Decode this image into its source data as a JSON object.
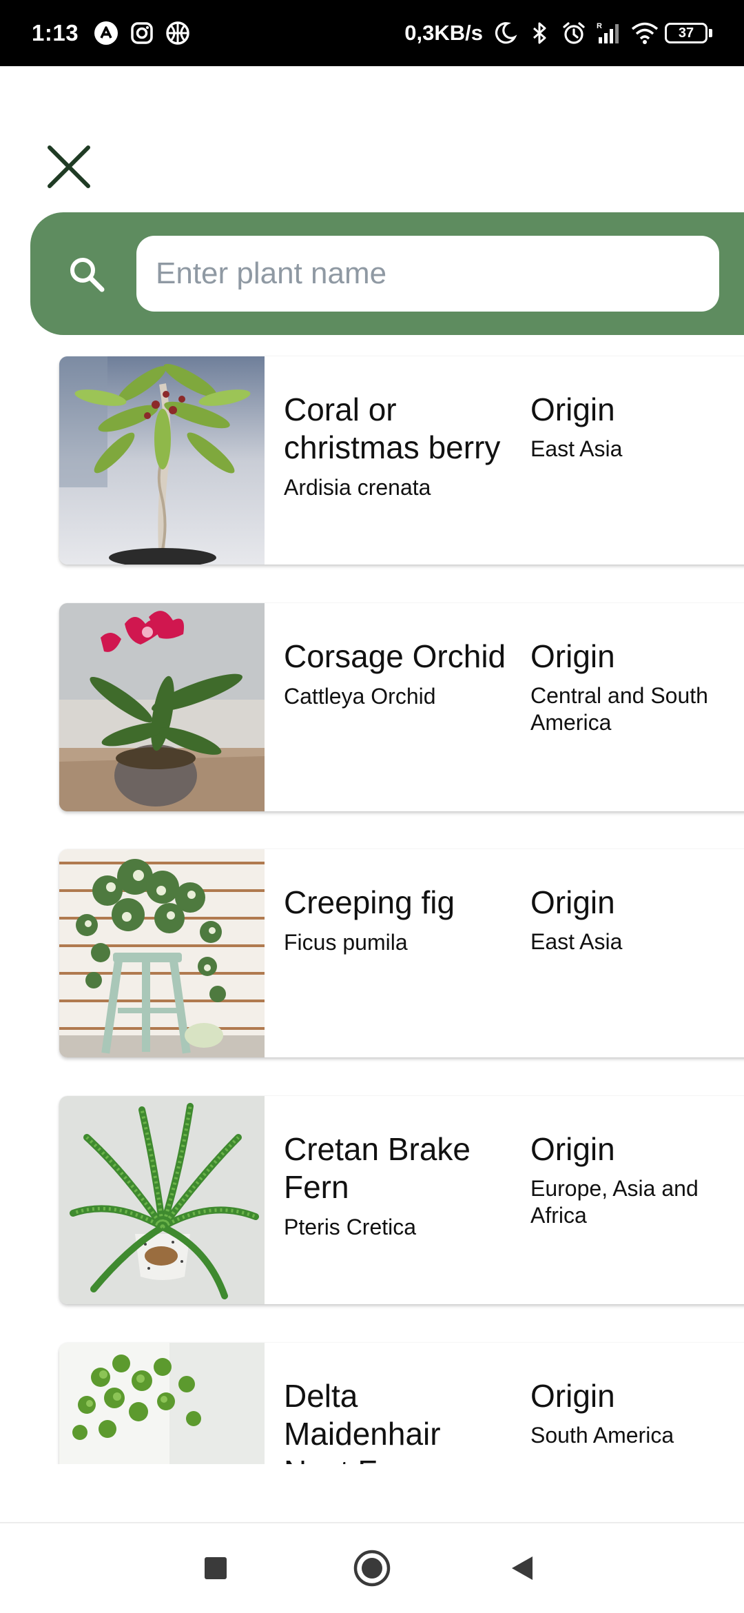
{
  "status_bar": {
    "time": "1:13",
    "network_speed": "0,3KB/s",
    "battery": "37",
    "left_icons": [
      "app-a-icon",
      "instagram-icon",
      "basketball-icon"
    ],
    "right_icons": [
      "moon-icon",
      "bluetooth-icon",
      "alarm-icon",
      "signal-icon",
      "wifi-icon",
      "battery-icon"
    ]
  },
  "header": {
    "close_icon": "close-icon"
  },
  "search": {
    "placeholder": "Enter plant name",
    "value": "",
    "icon": "search-icon"
  },
  "plants": [
    {
      "name": "Coral or christmas berry",
      "scientific": "Ardisia crenata",
      "origin_label": "Origin",
      "origin": "East Asia"
    },
    {
      "name": "Corsage Orchid",
      "scientific": "Cattleya Orchid",
      "origin_label": "Origin",
      "origin": "Central and South America"
    },
    {
      "name": "Creeping fig",
      "scientific": "Ficus pumila",
      "origin_label": "Origin",
      "origin": "East Asia"
    },
    {
      "name": "Cretan Brake Fern",
      "scientific": "Pteris Cretica",
      "origin_label": "Origin",
      "origin": "Europe, Asia and Africa"
    },
    {
      "name": "Delta Maidenhair Nest Fern",
      "scientific": "",
      "origin_label": "Origin",
      "origin": "South America"
    }
  ],
  "colors": {
    "accent": "#5e8c5f",
    "close_icon": "#1f3b24",
    "placeholder": "#8f99a3"
  },
  "nav": [
    "recents-icon",
    "home-icon",
    "back-icon"
  ]
}
